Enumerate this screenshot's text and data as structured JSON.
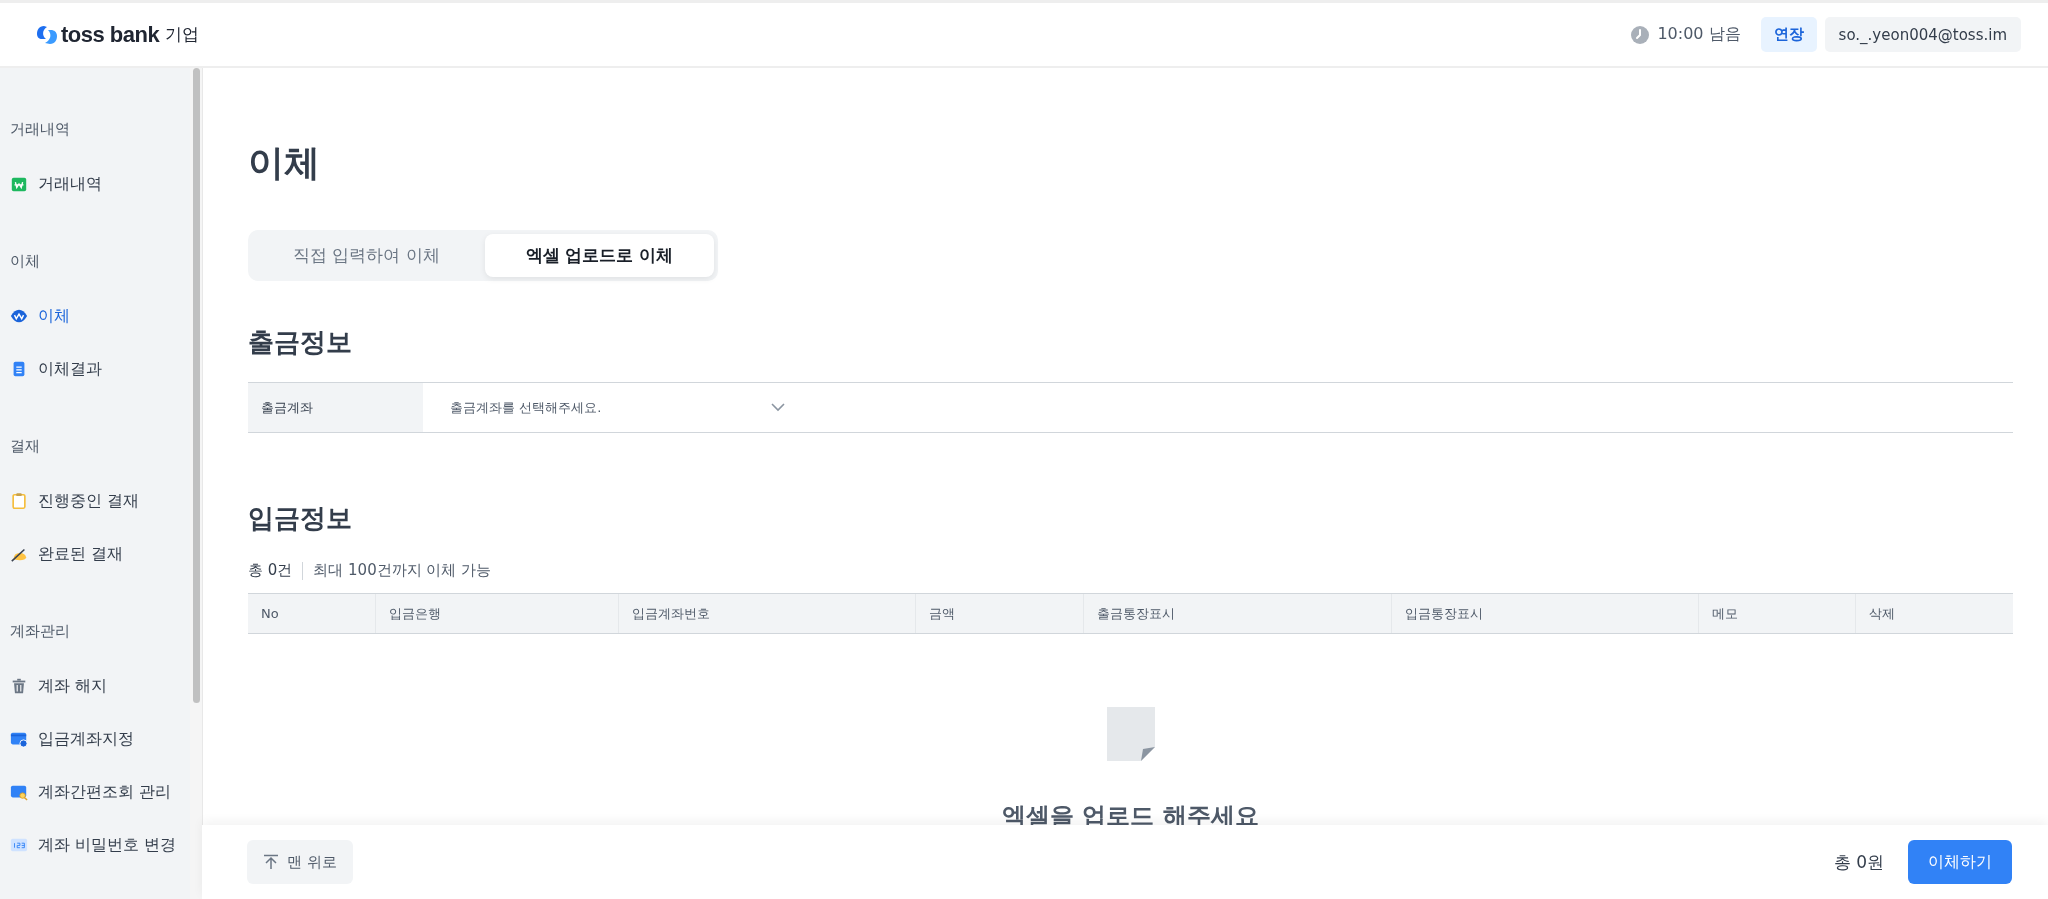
{
  "header": {
    "logo": "toss bank",
    "logo_suffix": "기업",
    "timer": "10:00 남음",
    "extend_button": "연장",
    "account": "so._.yeon004@toss.im"
  },
  "sidebar": {
    "sections": [
      {
        "title": "거래내역",
        "items": [
          {
            "label": "거래내역",
            "selected": false
          }
        ]
      },
      {
        "title": "이체",
        "items": [
          {
            "label": "이체",
            "selected": true
          },
          {
            "label": "이체결과",
            "selected": false
          }
        ]
      },
      {
        "title": "결재",
        "items": [
          {
            "label": "진행중인 결재",
            "selected": false
          },
          {
            "label": "완료된 결재",
            "selected": false
          }
        ]
      },
      {
        "title": "계좌관리",
        "items": [
          {
            "label": "계좌 해지",
            "selected": false
          },
          {
            "label": "입금계좌지정",
            "selected": false
          },
          {
            "label": "계좌간편조회 관리",
            "selected": false
          },
          {
            "label": "계좌 비밀번호 변경",
            "selected": false
          }
        ]
      }
    ]
  },
  "page": {
    "title": "이체",
    "tabs": [
      {
        "label": "직접 입력하여 이체",
        "selected": false
      },
      {
        "label": "엑셀 업로드로 이체",
        "selected": true
      }
    ],
    "withdrawal": {
      "heading": "출금정보",
      "field_label": "출금계좌",
      "placeholder": "출금계좌를 선택해주세요."
    },
    "deposit": {
      "heading": "입금정보",
      "count": "총 0건",
      "limit_note": "최대 100건까지 이체 가능",
      "table": {
        "columns": [
          "No",
          "입금은행",
          "입금계좌번호",
          "금액",
          "출금통장표시",
          "입금통장표시",
          "메모",
          "삭제"
        ]
      },
      "empty_message": "엑셀을 업로드 해주세요"
    }
  },
  "footer": {
    "top_button": "맨 위로",
    "total": "총 0원",
    "submit_button": "이체하기"
  }
}
